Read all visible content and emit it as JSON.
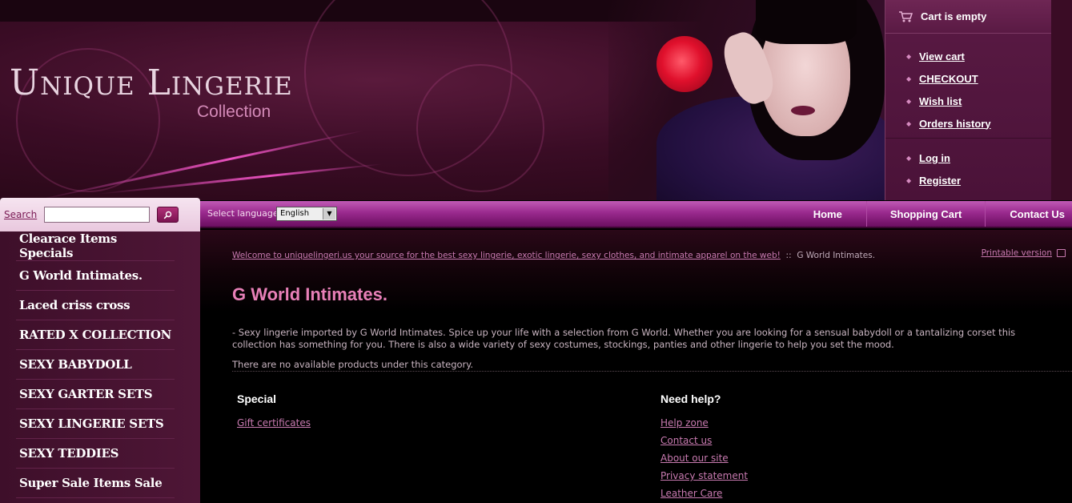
{
  "header": {
    "logo_main": "Unique Lingerie",
    "logo_sub": "Collection"
  },
  "cart": {
    "title": "Cart is empty",
    "links": [
      "View cart",
      "CHECKOUT",
      "Wish list",
      "Orders history"
    ],
    "account_links": [
      "Log in",
      "Register"
    ]
  },
  "search": {
    "label": "Search",
    "input_value": "",
    "button_icon": "search-icon"
  },
  "language": {
    "label": "Select language:",
    "selected": "English"
  },
  "nav": {
    "items": [
      "Home",
      "Shopping Cart",
      "Contact Us"
    ]
  },
  "sidebar": {
    "categories": [
      "Clearace Items Specials",
      "G World Intimates.",
      "Laced criss cross",
      "RATED X COLLECTION",
      "SEXY BABYDOLL",
      "SEXY GARTER SETS",
      "SEXY LINGERIE SETS",
      "SEXY TEDDIES",
      "Super Sale Items Sale"
    ]
  },
  "main": {
    "breadcrumb_link": "Welcome to uniquelingeri.us your source for the best sexy lingerie, exotic lingerie, sexy clothes, and intimate apparel on the web!",
    "breadcrumb_sep": "::",
    "breadcrumb_current": "G World Intimates.",
    "printable": "Printable version",
    "title": "G World Intimates.",
    "description": "- Sexy lingerie imported by G World Intimates. Spice up your life with a selection from G World. Whether you are looking for a sensual babydoll or a tantalizing corset this collection has something for you. There is also a wide variety of sexy costumes, stockings, panties and other lingerie to help you set the mood.",
    "no_products": "There are no available products under this category."
  },
  "footer": {
    "special_title": "Special",
    "special_links": [
      "Gift certificates"
    ],
    "help_title": "Need help?",
    "help_links": [
      "Help zone",
      "Contact us",
      "About our site",
      "Privacy statement",
      "Leather Care"
    ]
  },
  "colors": {
    "accent": "#e880b8",
    "link": "#c87ab0",
    "nav_bar": "#9a2a8e",
    "sidebar_bg": "#4e1636"
  }
}
